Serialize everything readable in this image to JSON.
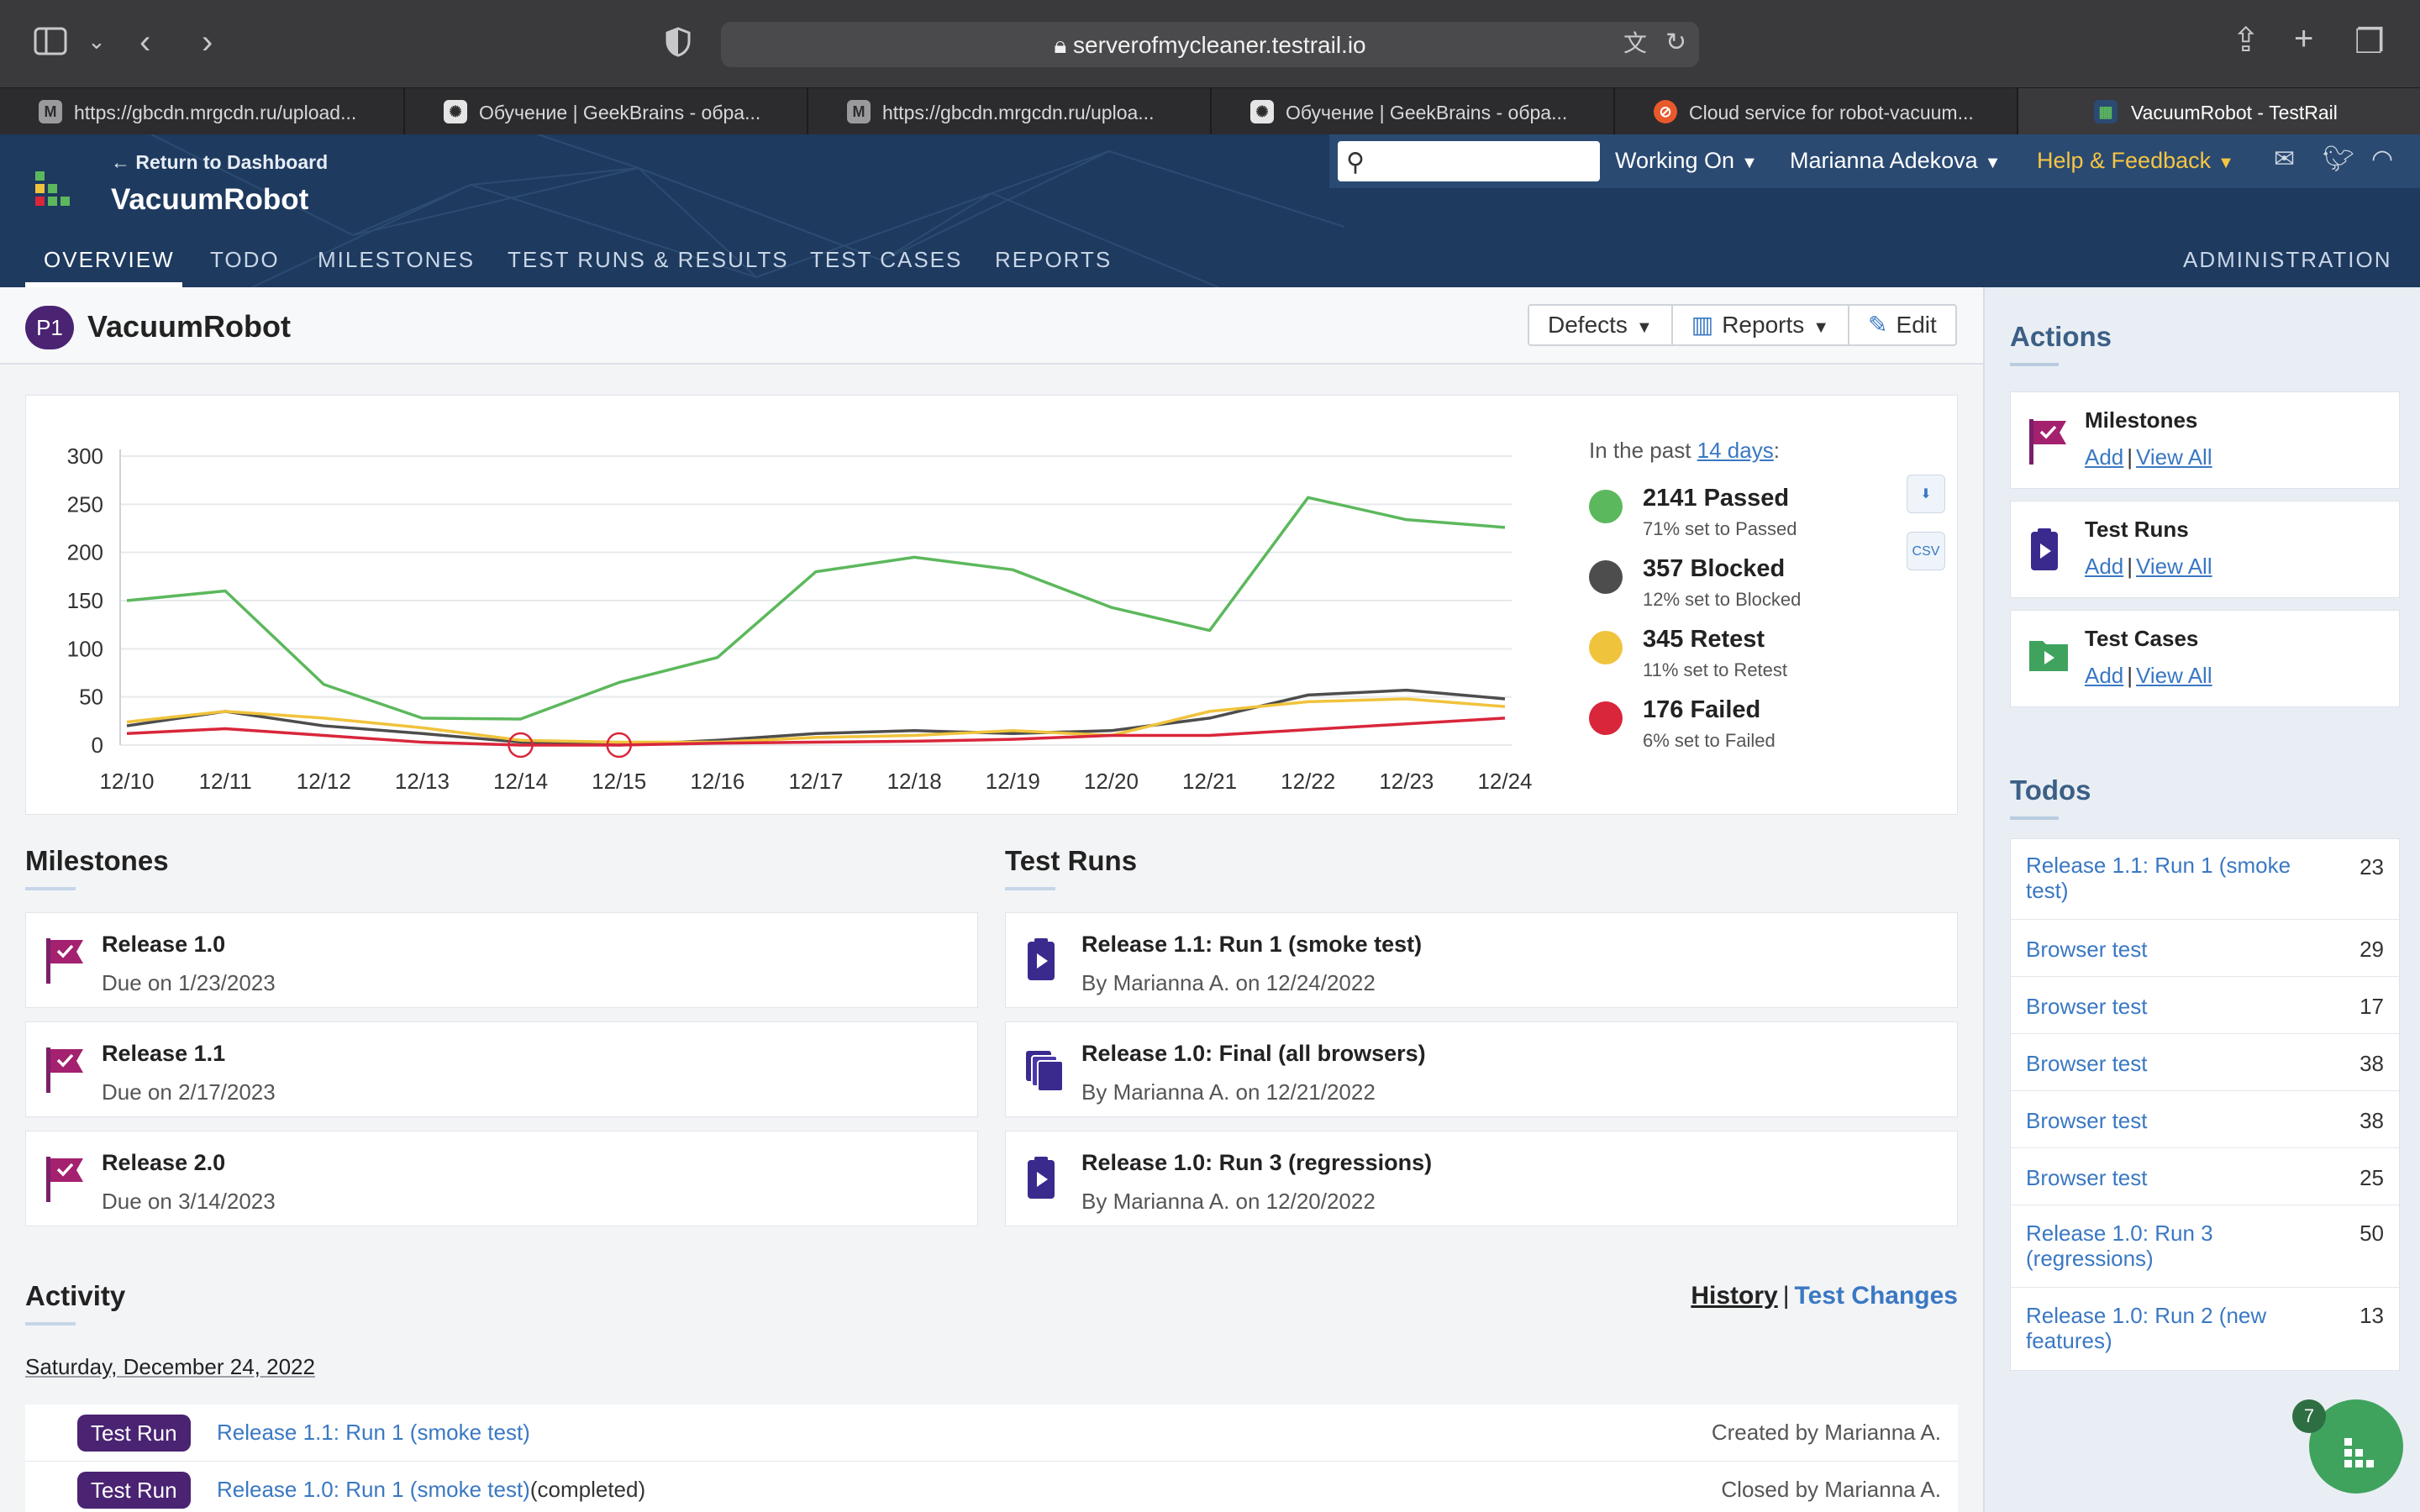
{
  "browser": {
    "url": "serverofmycleaner.testrail.io",
    "tabs": [
      {
        "icon": "M",
        "title": "https://gbcdn.mrgcdn.ru/upload..."
      },
      {
        "icon": "gpt",
        "title": "Обучение | GeekBrains - обра..."
      },
      {
        "icon": "M",
        "title": "https://gbcdn.mrgcdn.ru/uploa..."
      },
      {
        "icon": "gpt",
        "title": "Обучение | GeekBrains - обра..."
      },
      {
        "icon": "robot",
        "title": "Cloud service for robot-vacuum..."
      },
      {
        "icon": "testrail",
        "title": "VacuumRobot - TestRail"
      }
    ]
  },
  "header": {
    "return_label": "← Return to Dashboard",
    "project_name": "VacuumRobot",
    "search_placeholder": "",
    "working_on": "Working On",
    "user": "Marianna Adekova",
    "help": "Help & Feedback",
    "nav": [
      "OVERVIEW",
      "TODO",
      "MILESTONES",
      "TEST RUNS & RESULTS",
      "TEST CASES",
      "REPORTS"
    ],
    "admin": "ADMINISTRATION"
  },
  "page": {
    "badge": "P1",
    "title": "VacuumRobot",
    "buttons": {
      "defects": "Defects",
      "reports": "Reports",
      "edit": "Edit"
    }
  },
  "chart_data": {
    "type": "line",
    "categories": [
      "12/10",
      "12/11",
      "12/12",
      "12/13",
      "12/14",
      "12/15",
      "12/16",
      "12/17",
      "12/18",
      "12/19",
      "12/20",
      "12/21",
      "12/22",
      "12/23",
      "12/24"
    ],
    "yticks": [
      0,
      50,
      100,
      150,
      200,
      250,
      300
    ],
    "ylim": [
      0,
      300
    ],
    "grid": true,
    "series": [
      {
        "name": "Passed",
        "color": "#5cb85c",
        "values": [
          150,
          160,
          63,
          28,
          27,
          65,
          91,
          180,
          195,
          182,
          143,
          119,
          257,
          234,
          226
        ]
      },
      {
        "name": "Blocked",
        "color": "#4d4d4d",
        "values": [
          20,
          35,
          20,
          12,
          3,
          0,
          5,
          12,
          15,
          12,
          15,
          28,
          52,
          57,
          48
        ]
      },
      {
        "name": "Retest",
        "color": "#f0c33c",
        "values": [
          24,
          35,
          28,
          18,
          5,
          3,
          3,
          8,
          10,
          15,
          10,
          35,
          45,
          48,
          40
        ]
      },
      {
        "name": "Failed",
        "color": "#d9263b",
        "values": [
          12,
          17,
          10,
          3,
          0,
          0,
          2,
          3,
          4,
          6,
          10,
          10,
          16,
          22,
          28
        ]
      }
    ]
  },
  "legend": {
    "past_prefix": "In the past ",
    "past_link": "14 days",
    "past_suffix": ":",
    "items": [
      {
        "label": "2141 Passed",
        "sub": "71% set to Passed",
        "color": "#5cb85c"
      },
      {
        "label": "357 Blocked",
        "sub": "12% set to Blocked",
        "color": "#4d4d4d"
      },
      {
        "label": "345 Retest",
        "sub": "11% set to Retest",
        "color": "#f0c33c"
      },
      {
        "label": "176 Failed",
        "sub": "6% set to Failed",
        "color": "#d9263b"
      }
    ],
    "csv_label": "CSV"
  },
  "milestones": {
    "heading": "Milestones",
    "items": [
      {
        "title": "Release 1.0",
        "sub": "Due on 1/23/2023"
      },
      {
        "title": "Release 1.1",
        "sub": "Due on 2/17/2023"
      },
      {
        "title": "Release 2.0",
        "sub": "Due on 3/14/2023"
      }
    ]
  },
  "test_runs": {
    "heading": "Test Runs",
    "items": [
      {
        "title": "Release 1.1: Run 1 (smoke test)",
        "sub": "By Marianna A. on 12/24/2022"
      },
      {
        "title": "Release 1.0: Final (all browsers)",
        "sub": "By Marianna A. on 12/21/2022"
      },
      {
        "title": "Release 1.0: Run 3 (regressions)",
        "sub": "By Marianna A. on 12/20/2022"
      }
    ]
  },
  "activity": {
    "heading": "Activity",
    "history": "History",
    "sep": "|",
    "test_changes": "Test Changes",
    "date": "Saturday, December 24, 2022",
    "rows": [
      {
        "badge": "Test Run",
        "link": "Release 1.1: Run 1 (smoke test)",
        "suffix": "",
        "by": "Created by Marianna A."
      },
      {
        "badge": "Test Run",
        "link": "Release 1.0: Run 1 (smoke test)",
        "suffix": "(completed)",
        "by": "Closed by Marianna A."
      }
    ]
  },
  "sidebar": {
    "actions_heading": "Actions",
    "actions": [
      {
        "title": "Milestones",
        "add": "Add",
        "sep": "|",
        "view": "View All"
      },
      {
        "title": "Test Runs",
        "add": "Add",
        "sep": "|",
        "view": "View All"
      },
      {
        "title": "Test Cases",
        "add": "Add",
        "sep": "|",
        "view": "View All"
      }
    ],
    "todos_heading": "Todos",
    "todos": [
      {
        "label": "Release 1.1: Run 1 (smoke test)",
        "count": "23"
      },
      {
        "label": "Browser test",
        "count": "29"
      },
      {
        "label": "Browser test",
        "count": "17"
      },
      {
        "label": "Browser test",
        "count": "38"
      },
      {
        "label": "Browser test",
        "count": "38"
      },
      {
        "label": "Browser test",
        "count": "25"
      },
      {
        "label": "Release 1.0: Run 3 (regressions)",
        "count": "50"
      },
      {
        "label": "Release 1.0: Run 2 (new features)",
        "count": "13"
      }
    ],
    "fab_badge": "7"
  }
}
